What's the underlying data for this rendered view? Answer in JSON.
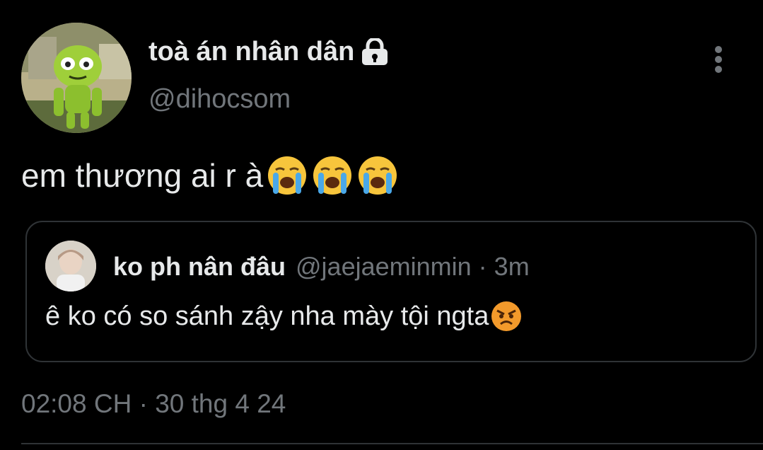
{
  "author": {
    "display_name": "toà án nhân dân",
    "handle": "@dihocsom",
    "protected_icon": "lock-icon",
    "avatar_icon": "green-character-avatar"
  },
  "menu_icon": "more-vertical-icon",
  "tweet": {
    "text": "em thương ai r à",
    "emojis": [
      "loudly-crying-face",
      "loudly-crying-face",
      "loudly-crying-face"
    ]
  },
  "quoted_tweet": {
    "display_name": "ko ph nân đâu",
    "handle": "@jaejaeminmin",
    "separator": " · ",
    "time": "3m",
    "text": "ê ko có so sánh zậy nha mày tội ngta",
    "emoji": "angry-face"
  },
  "timestamp": "02:08 CH · 30 thg 4 24",
  "colors": {
    "background": "#000000",
    "primary_text": "#e7e9ea",
    "secondary_text": "#71767b",
    "border": "#2f3336"
  }
}
